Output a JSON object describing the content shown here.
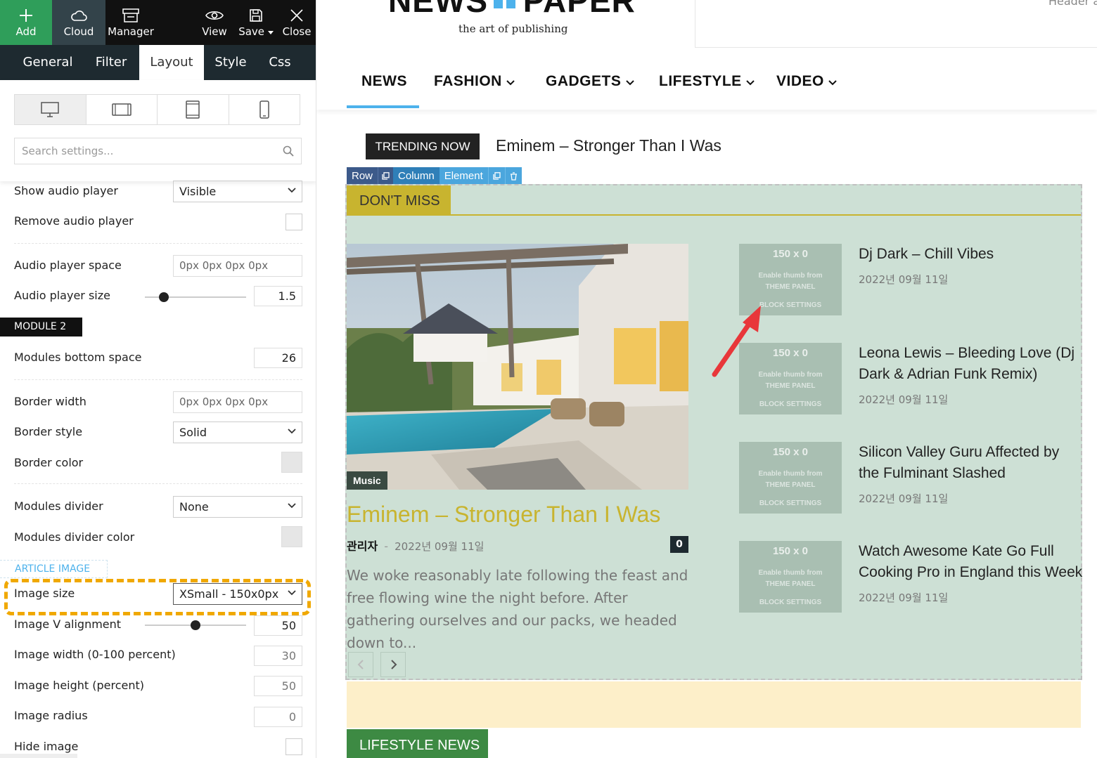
{
  "toolbar": {
    "add": "Add",
    "cloud": "Cloud",
    "manager": "Manager",
    "view": "View",
    "save": "Save",
    "close": "Close"
  },
  "tabs": [
    "General",
    "Filter",
    "Layout",
    "Style",
    "Css"
  ],
  "active_tab": "Layout",
  "search": {
    "placeholder": "Search settings..."
  },
  "settings": {
    "show_audio_player": {
      "label": "Show audio player",
      "value": "Visible"
    },
    "remove_audio_player": {
      "label": "Remove audio player"
    },
    "audio_player_space": {
      "label": "Audio player space",
      "value": "0px 0px 0px 0px"
    },
    "audio_player_size": {
      "label": "Audio player size",
      "value": "1.5"
    },
    "module2_header": "MODULE 2",
    "modules_bottom_space": {
      "label": "Modules bottom space",
      "value": "26"
    },
    "border_width": {
      "label": "Border width",
      "value": "0px 0px 0px 0px"
    },
    "border_style": {
      "label": "Border style",
      "value": "Solid"
    },
    "border_color": {
      "label": "Border color"
    },
    "modules_divider": {
      "label": "Modules divider",
      "value": "None"
    },
    "modules_divider_color": {
      "label": "Modules divider color"
    },
    "article_image_header": "ARTICLE IMAGE",
    "image_size": {
      "label": "Image size",
      "value": "XSmall - 150x0px"
    },
    "image_v_alignment": {
      "label": "Image V alignment",
      "value": "50"
    },
    "image_width": {
      "label": "Image width (0-100 percent)",
      "value": "30"
    },
    "image_height": {
      "label": "Image height (percent)",
      "value": "50"
    },
    "image_radius": {
      "label": "Image radius",
      "value": "0"
    },
    "hide_image": {
      "label": "Hide image"
    }
  },
  "site": {
    "logo_left": "NEWS",
    "logo_right": "PAPER",
    "tagline": "the art of publishing",
    "header_ad": "Header a",
    "nav": [
      "NEWS",
      "FASHION",
      "GADGETS",
      "LIFESTYLE",
      "VIDEO"
    ],
    "trending_label": "TRENDING NOW",
    "trending_title": "Eminem – Stronger Than I Was",
    "editor_bar": {
      "row": "Row",
      "column": "Column",
      "element": "Element"
    },
    "block_title": "DON'T MISS",
    "main_article": {
      "category": "Music",
      "title": "Eminem – Stronger Than I Was",
      "author": "관리자",
      "date": "2022년 09월 11일",
      "comments": "0",
      "excerpt": "We woke reasonably late following the feast and free flowing wine the night before. After gathering ourselves and our packs, we headed down to..."
    },
    "thumb_placeholder": {
      "size": "150 x 0",
      "line1": "Enable thumb from",
      "line2": "THEME PANEL",
      "line3": "BLOCK SETTINGS"
    },
    "side_articles": [
      {
        "title": "Dj Dark – Chill Vibes",
        "date": "2022년 09월 11일"
      },
      {
        "title": "Leona Lewis – Bleeding Love (Dj Dark & Adrian Funk Remix)",
        "date": "2022년 09월 11일"
      },
      {
        "title": "Silicon Valley Guru Affected by the Fulminant Slashed",
        "date": "2022년 09월 11일"
      },
      {
        "title": "Watch Awesome Kate Go Full Cooking Pro in England this Week",
        "date": "2022년 09월 11일"
      }
    ],
    "lifestyle_title": "LIFESTYLE NEWS"
  },
  "colors": {
    "toolbar_green": "#2f9e5a",
    "toolbar_dark": "#111111",
    "tabs_bg": "#1e2a30",
    "accent_yellow": "#c8b42f",
    "block_bg": "#cde0d5",
    "nav_active_underline": "#4db2ec",
    "highlight_outline": "#f0a800",
    "lifestyle_green": "#3d8a43",
    "arrow_red": "#e8373a"
  }
}
